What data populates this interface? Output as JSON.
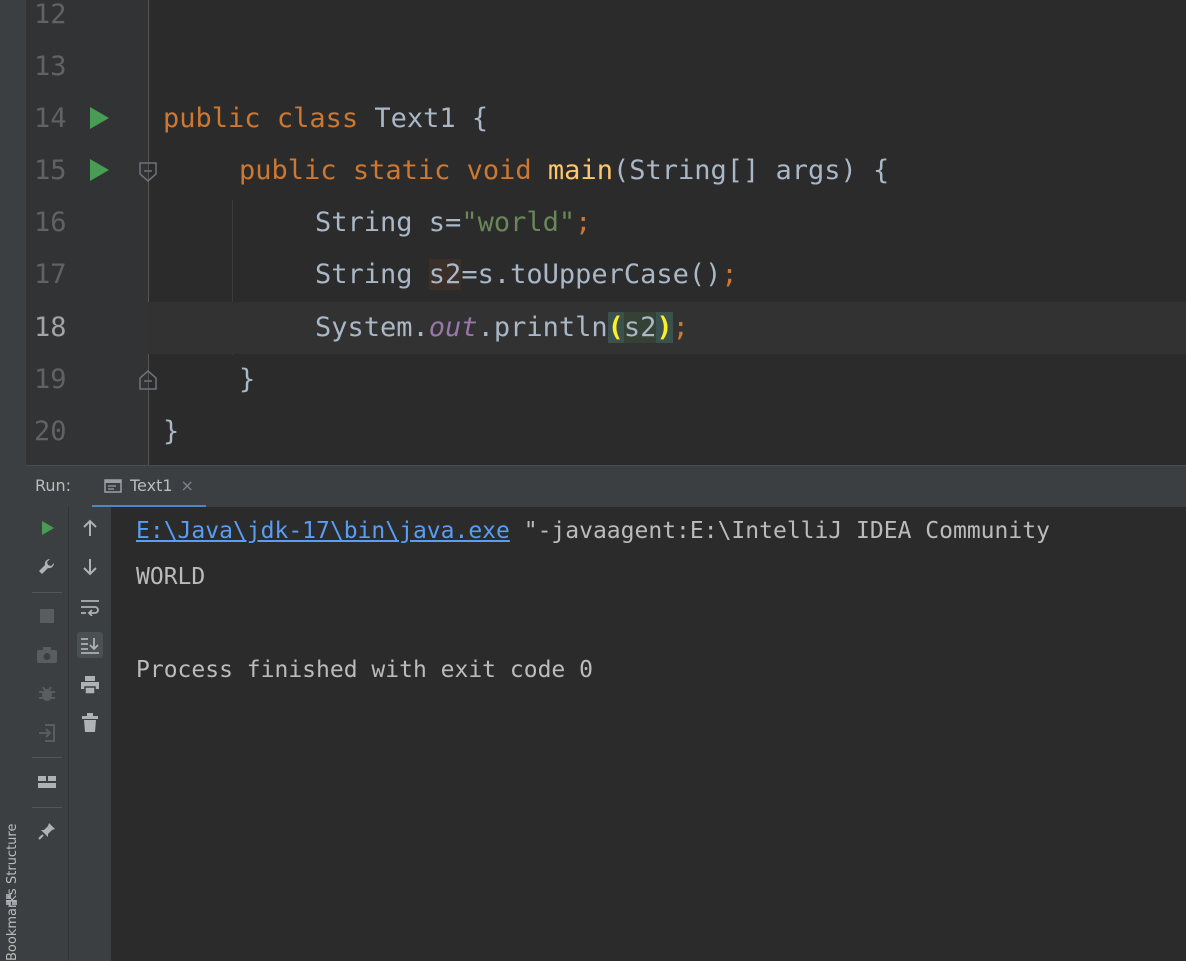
{
  "editor": {
    "lines": [
      {
        "num": "12"
      },
      {
        "num": "13"
      },
      {
        "num": "14",
        "tokens": [
          "public",
          "class",
          "Text1 {"
        ]
      },
      {
        "num": "15",
        "tokens": [
          "public",
          "static",
          "void",
          "main",
          "(String[] args) {"
        ]
      },
      {
        "num": "16",
        "tokens": [
          "String s=",
          "\"world\"",
          ";"
        ]
      },
      {
        "num": "17",
        "tokens": [
          "String ",
          "s2",
          "=s.toUpperCase()",
          ";"
        ]
      },
      {
        "num": "18",
        "tokens": [
          "System.",
          "out",
          ".println",
          "(",
          "s2",
          ")",
          ";"
        ]
      },
      {
        "num": "19",
        "tokens": [
          "}"
        ]
      },
      {
        "num": "20",
        "tokens": [
          "}"
        ]
      }
    ],
    "current_line": "18"
  },
  "run_panel": {
    "label": "Run:",
    "tab_label": "Text1",
    "tab_close": "×",
    "toolbar_left": [
      "rerun-icon",
      "wrench-icon",
      "stop-icon",
      "camera-icon",
      "debug-icon",
      "exit-icon",
      "layout-icon",
      "pin-icon"
    ],
    "toolbar_right": [
      "arrow-up-icon",
      "arrow-down-icon",
      "soft-wrap-icon",
      "scroll-to-end-icon",
      "print-icon",
      "trash-icon"
    ]
  },
  "console": {
    "cmd_link": "E:\\Java\\jdk-17\\bin\\java.exe",
    "cmd_rest": " \"-javaagent:E:\\IntelliJ IDEA Community",
    "output": "WORLD",
    "exit_msg": "Process finished with exit code 0"
  },
  "side_tabs": {
    "structure": "Structure",
    "bookmarks": "Bookmarks"
  },
  "colors": {
    "background": "#2b2b2b",
    "keyword": "#cc7832",
    "string": "#6a8759",
    "method": "#ffc66d",
    "static_field": "#9876aa",
    "run_green": "#499c54",
    "link": "#589df6"
  }
}
